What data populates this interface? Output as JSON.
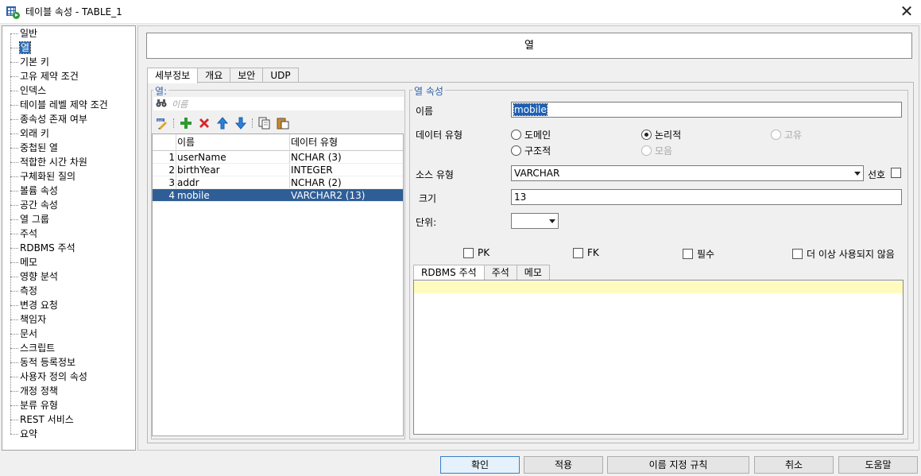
{
  "window": {
    "title": "테이블 속성 - TABLE_1"
  },
  "tree": {
    "items": [
      "일반",
      "열",
      "기본 키",
      "고유 제약 조건",
      "인덱스",
      "테이블 레벨 제약 조건",
      "종속성 존재 여부",
      "외래 키",
      "중첩된 열",
      "적합한 시간 차원",
      "구체화된 질의",
      "볼륨 속성",
      "공간 속성",
      "열 그룹",
      "주석",
      "RDBMS 주석",
      "메모",
      "영향 분석",
      "측정",
      "변경 요청",
      "책임자",
      "문서",
      "스크립트",
      "동적 등록정보",
      "사용자 정의 속성",
      "개정 정책",
      "분류 유형",
      "REST 서비스",
      "요약"
    ],
    "selected_index": 1
  },
  "header": {
    "title": "열"
  },
  "tabs": [
    "세부정보",
    "개요",
    "보안",
    "UDP"
  ],
  "columns_group": {
    "label": "열:",
    "search_placeholder": "이름",
    "headers": [
      "이름",
      "데이터 유형"
    ],
    "rows": [
      {
        "n": "1",
        "name": "userName",
        "type": "NCHAR (3)"
      },
      {
        "n": "2",
        "name": "birthYear",
        "type": "INTEGER"
      },
      {
        "n": "3",
        "name": "addr",
        "type": "NCHAR (2)"
      },
      {
        "n": "4",
        "name": "mobile",
        "type": "VARCHAR2 (13)"
      }
    ],
    "selected_row": 3
  },
  "props": {
    "label": "열 속성",
    "name_label": "이름",
    "name_value": "mobile",
    "datatype_label": "데이터 유형",
    "radios": {
      "domain": "도메인",
      "logical": "논리적",
      "unique": "고유",
      "structural": "구조적",
      "collection": "모음"
    },
    "source_type_label": "소스 유형",
    "source_type_value": "VARCHAR",
    "preferred_label": "선호",
    "size_label": "크기",
    "size_value": "13",
    "unit_label": "단위:",
    "checks": {
      "pk": "PK",
      "fk": "FK",
      "required": "필수",
      "deprecated": "더 이상 사용되지 않음"
    },
    "subtabs": [
      "RDBMS 주석",
      "주석",
      "메모"
    ]
  },
  "buttons": {
    "ok": "확인",
    "apply": "적용",
    "naming_rules": "이름 지정 규칙",
    "cancel": "취소",
    "help": "도움말"
  },
  "colors": {
    "selection": "#2f5e97",
    "note_highlight": "#fffbbf",
    "accent": "#2b5fa8"
  }
}
